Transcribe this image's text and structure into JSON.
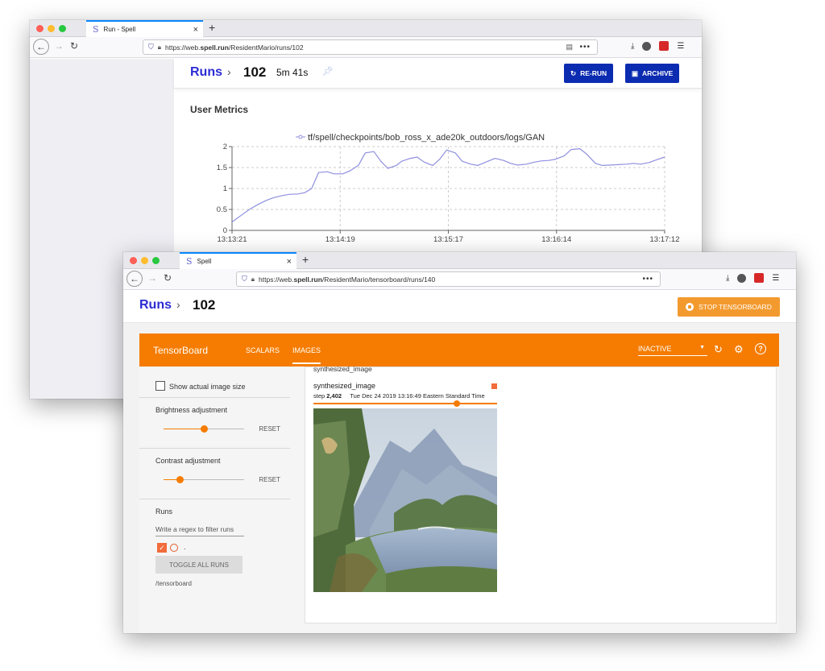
{
  "back": {
    "tab_title": "Run - Spell",
    "url_prefix": "https://web.",
    "url_domain": "spell.run",
    "url_path": "/ResidentMario/runs/102",
    "breadcrumb_runs": "Runs",
    "run_number": "102",
    "duration": "5m 41s",
    "rerun_label": "RE-RUN",
    "archive_label": "ARCHIVE",
    "metrics_title": "User Metrics"
  },
  "front": {
    "tab_title": "Spell",
    "url_prefix": "https://web.",
    "url_domain": "spell.run",
    "url_path": "/ResidentMario/tensorboard/runs/140",
    "breadcrumb_runs": "Runs",
    "run_number": "102",
    "stop_label": "STOP TENSORBOARD",
    "tensorboard": {
      "title": "TensorBoard",
      "tabs": [
        {
          "label": "SCALARS"
        },
        {
          "label": "IMAGES"
        }
      ],
      "status_select": "INACTIVE",
      "show_actual_size": "Show actual image size",
      "brightness": "Brightness adjustment",
      "brightness_level": 0.5,
      "contrast": "Contrast adjustment",
      "contrast_level": 0.2,
      "reset": "RESET",
      "runs_label": "Runs",
      "filter_placeholder": "Write a regex to filter runs",
      "run_name": ".",
      "toggle_all": "TOGGLE ALL RUNS",
      "log_dir": "/tensorboard",
      "card_tag": "synthesized_image",
      "card_title": "synthesized_image",
      "step_label": "step",
      "step_value": "2,402",
      "timestamp": "Tue Dec 24 2019 13:16:49 Eastern Standard Time",
      "step_position": 0.78
    }
  },
  "chart_data": {
    "type": "line",
    "legend": [
      "tf/spell/checkpoints/bob_ross_x_ade20k_outdoors/logs/GAN"
    ],
    "color": "#8f8fe0",
    "x_ticks": [
      "13:13:21",
      "13:14:19",
      "13:15:17",
      "13:16:14",
      "13:17:12"
    ],
    "y_ticks": [
      "0",
      "0.5",
      "1",
      "1.5",
      "2"
    ],
    "ylim": [
      0,
      2
    ],
    "grid": true,
    "series": [
      {
        "name": "tf/spell/checkpoints/bob_ross_x_ade20k_outdoors/logs/GAN",
        "x": [
          0,
          0.5,
          1,
          1.5,
          2,
          2.4,
          2.9,
          3.3,
          3.8,
          4.2,
          4.6,
          5.0,
          5.5,
          5.9,
          6.4,
          6.8,
          7.3,
          7.7,
          8.2,
          8.6,
          9.0,
          9.5,
          9.8,
          10.3,
          10.7,
          11.1,
          11.6,
          12.0,
          12.4,
          12.9,
          13.3,
          13.8,
          14.2,
          14.6,
          15.2,
          15.7,
          16.1,
          16.5,
          17.0,
          17.5,
          17.9,
          18.3,
          18.7,
          19.2,
          19.6,
          20.1,
          20.5,
          21.0,
          21.4,
          21.9,
          22.3,
          22.8,
          23.2,
          23.6,
          24.1,
          24.5,
          25.0
        ],
        "y": [
          0.2,
          0.35,
          0.5,
          0.62,
          0.72,
          0.78,
          0.83,
          0.86,
          0.87,
          0.9,
          1.0,
          1.38,
          1.4,
          1.35,
          1.35,
          1.42,
          1.55,
          1.85,
          1.88,
          1.65,
          1.48,
          1.55,
          1.65,
          1.72,
          1.75,
          1.63,
          1.55,
          1.7,
          1.92,
          1.85,
          1.65,
          1.58,
          1.55,
          1.62,
          1.72,
          1.67,
          1.6,
          1.56,
          1.58,
          1.63,
          1.66,
          1.67,
          1.7,
          1.78,
          1.93,
          1.95,
          1.82,
          1.6,
          1.55,
          1.56,
          1.57,
          1.58,
          1.6,
          1.58,
          1.62,
          1.68,
          1.75
        ]
      }
    ]
  }
}
